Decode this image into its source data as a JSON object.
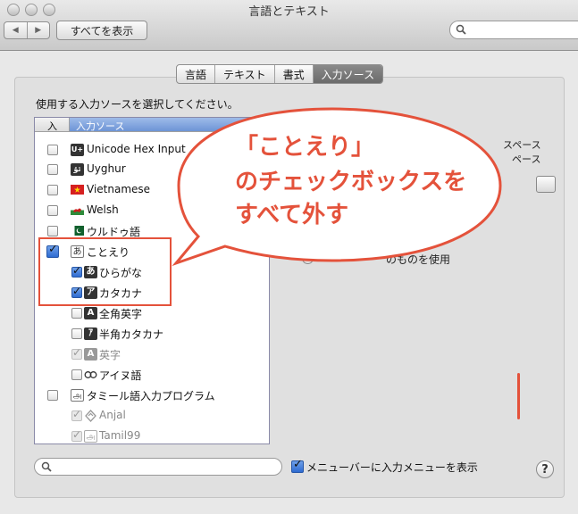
{
  "window": {
    "title": "言語とテキスト"
  },
  "toolbar": {
    "back": "◀",
    "forward": "▶",
    "show_all": "すべてを表示",
    "search_placeholder": ""
  },
  "tabs": [
    {
      "label": "言語",
      "active": false
    },
    {
      "label": "テキスト",
      "active": false
    },
    {
      "label": "書式",
      "active": false
    },
    {
      "label": "入力ソース",
      "active": true
    }
  ],
  "main": {
    "prompt": "使用する入力ソースを選択してください。",
    "list_header": {
      "col1": "入",
      "col2": "入力ソース"
    },
    "items": [
      {
        "label": "Unicode Hex Input",
        "icon": "U+",
        "checked": false
      },
      {
        "label": "Uyghur",
        "icon": "ئۇ",
        "checked": false
      },
      {
        "label": "Vietnamese",
        "icon": "vietnam-flag",
        "checked": false
      },
      {
        "label": "Welsh",
        "icon": "wales-flag",
        "checked": false
      },
      {
        "label": "ウルドゥ語",
        "icon": "pakistan-flag",
        "checked": false
      },
      {
        "label": "ことえり",
        "icon": "あ",
        "checked": true
      },
      {
        "label": "ひらがな",
        "icon": "あ",
        "checked": true
      },
      {
        "label": "カタカナ",
        "icon": "ア",
        "checked": true
      },
      {
        "label": "全角英字",
        "icon": "A",
        "checked": false
      },
      {
        "label": "半角カタカナ",
        "icon": "ｱ",
        "checked": false
      },
      {
        "label": "英字",
        "icon": "A",
        "checked": true,
        "disabled": true
      },
      {
        "label": "アイヌ語",
        "icon": "ainu-icon",
        "checked": false
      },
      {
        "label": "タミール語入力プログラム",
        "icon": "அ",
        "checked": false
      },
      {
        "label": "Anjal",
        "icon": "anjal-icon",
        "checked": true,
        "disabled": true
      },
      {
        "label": "Tamil99",
        "icon": "அ",
        "checked": true,
        "disabled": true
      }
    ],
    "right_partial": {
      "line1": "スペース",
      "line2": "ペース",
      "line3": "のものを使用"
    }
  },
  "footer": {
    "search_placeholder": "",
    "menu_label": "メニューバーに入力メニューを表示",
    "menu_checked": true,
    "help": "?"
  },
  "annotation": {
    "line1": "「ことえり」",
    "line2": "のチェックボックスを",
    "line3": "すべて外す",
    "color": "#e4523b"
  }
}
